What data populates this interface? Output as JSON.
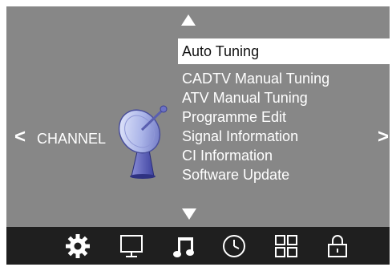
{
  "header": {
    "up_arrow": "up-arrow-icon",
    "down_arrow": "down-arrow-icon"
  },
  "nav": {
    "prev": "<",
    "next": ">",
    "section": "CHANNEL"
  },
  "menu": {
    "items": [
      {
        "label": "Auto Tuning",
        "selected": true
      },
      {
        "label": "CADTV Manual Tuning"
      },
      {
        "label": "ATV Manual Tuning"
      },
      {
        "label": "Programme Edit"
      },
      {
        "label": "Signal Information"
      },
      {
        "label": "CI Information"
      },
      {
        "label": "Software Update"
      }
    ]
  },
  "bottom_bar": {
    "icons": [
      "gear-icon",
      "monitor-icon",
      "music-note-icon",
      "clock-icon",
      "grid-icon",
      "lock-icon"
    ],
    "active_icon": "music-note-icon"
  },
  "colors": {
    "panel": "#878787",
    "bottom_bar": "#1f1f1f",
    "highlight": "#ffffff",
    "text": "#ffffff"
  }
}
